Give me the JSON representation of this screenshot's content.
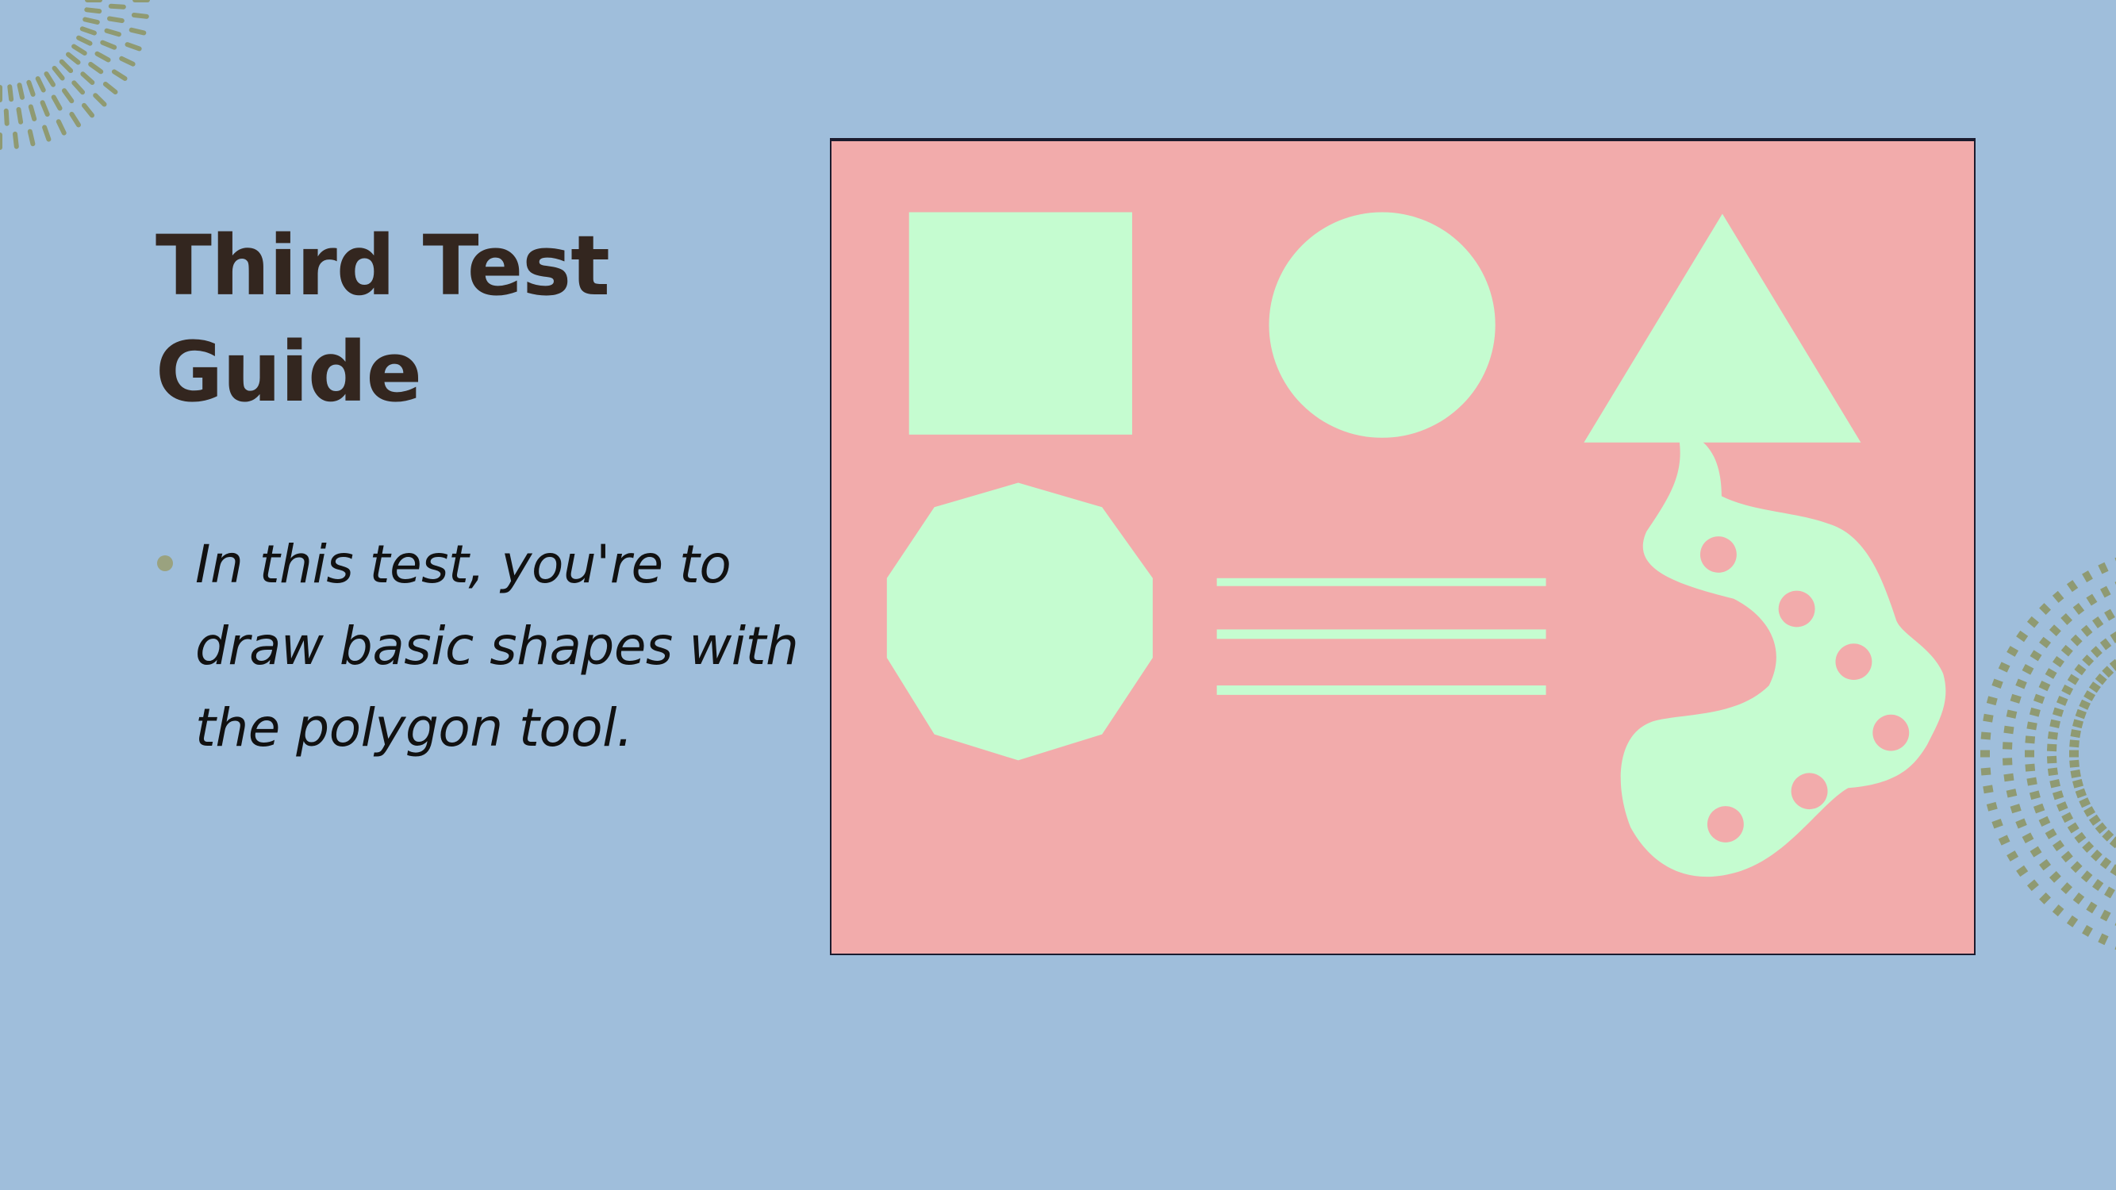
{
  "slide": {
    "title": "Third Test Guide",
    "bullets": [
      "In this test, you're to draw basic shapes with the polygon tool."
    ]
  },
  "colors": {
    "background": "#9fbedb",
    "title": "#33261f",
    "body_text": "#111111",
    "bullet_marker": "#9aa27f",
    "decoration": "#8f9a72",
    "picture_background": "#f2abab",
    "shape_fill": "#c5fcd0"
  },
  "picture": {
    "shapes": [
      "square",
      "circle",
      "triangle",
      "decagon",
      "three-lines",
      "blob-with-holes"
    ]
  }
}
